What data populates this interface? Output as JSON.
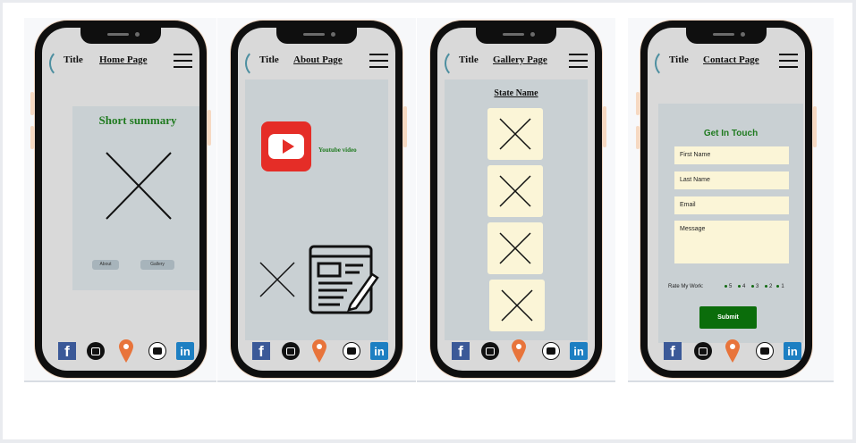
{
  "phones": [
    {
      "title": "Title",
      "page_name": "Home Page",
      "summary_heading": "Short summary",
      "buttons": [
        "About",
        "Gallery"
      ]
    },
    {
      "title": "Title",
      "page_name": "About Page",
      "video_label": "Youtube video"
    },
    {
      "title": "Title",
      "page_name": "Gallery Page",
      "state_name": "State Name"
    },
    {
      "title": "Title",
      "page_name": "Contact Page",
      "form_heading": "Get In Touch",
      "fields": [
        "First Name",
        "Last Name",
        "Email",
        "Message"
      ],
      "rating_label": "Rate My Work:",
      "rating_options": [
        "5",
        "4",
        "3",
        "2",
        "1"
      ],
      "submit_label": "Submit"
    }
  ],
  "footer": {
    "facebook": "f",
    "linkedin": "in"
  },
  "colors": {
    "accent_green": "#0b6d0b",
    "youtube_red": "#e52d27",
    "pin_orange": "#e8743b",
    "facebook_blue": "#3b5998",
    "linkedin_blue": "#1d7fc2",
    "content_gray": "#c9d0d3",
    "field_cream": "#fbf5d7"
  },
  "icons": [
    "menu-icon",
    "facebook-icon",
    "instagram-icon",
    "location-pin-icon",
    "youtube-icon",
    "linkedin-icon",
    "image-placeholder-icon",
    "article-edit-icon"
  ]
}
